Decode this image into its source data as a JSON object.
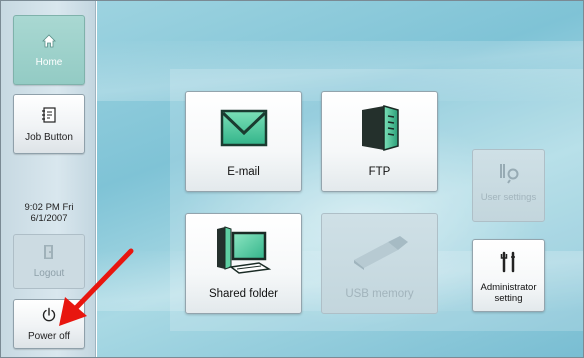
{
  "sidebar": {
    "home_label": "Home",
    "job_label": "Job Button",
    "clock_line1": "9:02 PM  Fri",
    "clock_line2": "6/1/2007",
    "logout_label": "Logout",
    "power_label": "Power off"
  },
  "tiles": {
    "email": "E-mail",
    "ftp": "FTP",
    "shared": "Shared folder",
    "usb": "USB memory",
    "user_settings": "User settings",
    "admin_line1": "Administrator",
    "admin_line2": "setting"
  },
  "states": {
    "home": "selected",
    "logout": "disabled",
    "usb": "disabled",
    "user_settings": "disabled"
  },
  "annotation": {
    "color": "#e8160f",
    "target": "Power off"
  },
  "icons": [
    "home-icon",
    "job-button-icon",
    "logout-door-icon",
    "power-icon",
    "email-envelope-icon",
    "ftp-server-icon",
    "shared-folder-computer-icon",
    "usb-stick-icon",
    "user-settings-tools-icon",
    "admin-tools-icon"
  ]
}
